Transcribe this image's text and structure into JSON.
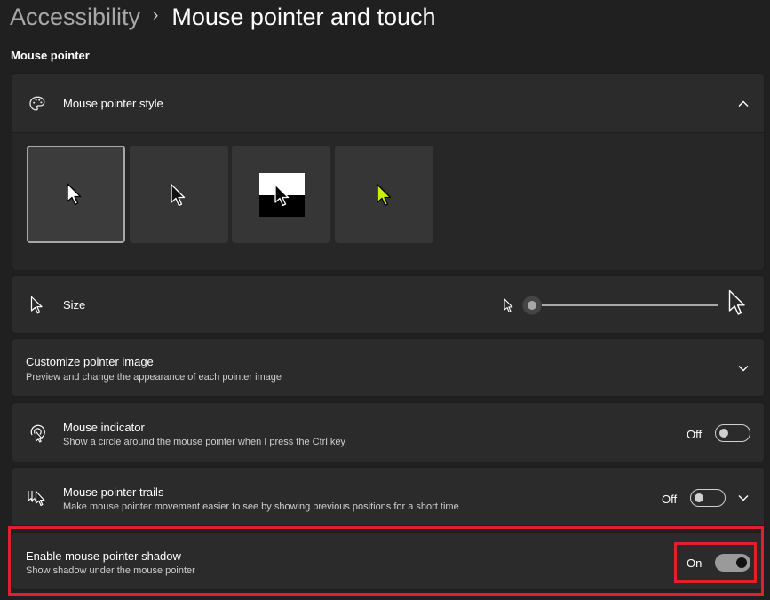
{
  "breadcrumb": {
    "parent": "Accessibility",
    "separator": "›",
    "current": "Mouse pointer and touch"
  },
  "section": {
    "title": "Mouse pointer"
  },
  "pointer_style": {
    "title": "Mouse pointer style",
    "icon": "palette-icon",
    "expanded": true,
    "options": [
      {
        "name": "white",
        "selected": true
      },
      {
        "name": "black",
        "selected": false
      },
      {
        "name": "inverted",
        "selected": false
      },
      {
        "name": "custom",
        "selected": false,
        "color": "#c8f000"
      }
    ]
  },
  "size": {
    "title": "Size",
    "icon": "pointer-icon",
    "slider_value": 0
  },
  "customize": {
    "title": "Customize pointer image",
    "subtitle": "Preview and change the appearance of each pointer image"
  },
  "indicator": {
    "title": "Mouse indicator",
    "subtitle": "Show a circle around the mouse pointer when I press the Ctrl key",
    "icon": "mouse-indicator-icon",
    "state": "Off"
  },
  "trails": {
    "title": "Mouse pointer trails",
    "subtitle": "Make mouse pointer movement easier to see by showing previous positions for a short time",
    "icon": "pointer-trails-icon",
    "state": "Off"
  },
  "shadow": {
    "title": "Enable mouse pointer shadow",
    "subtitle": "Show shadow under the mouse pointer",
    "state": "On"
  },
  "colors": {
    "highlight": "#e0202a",
    "card": "#2b2b2b",
    "background": "#202020"
  }
}
